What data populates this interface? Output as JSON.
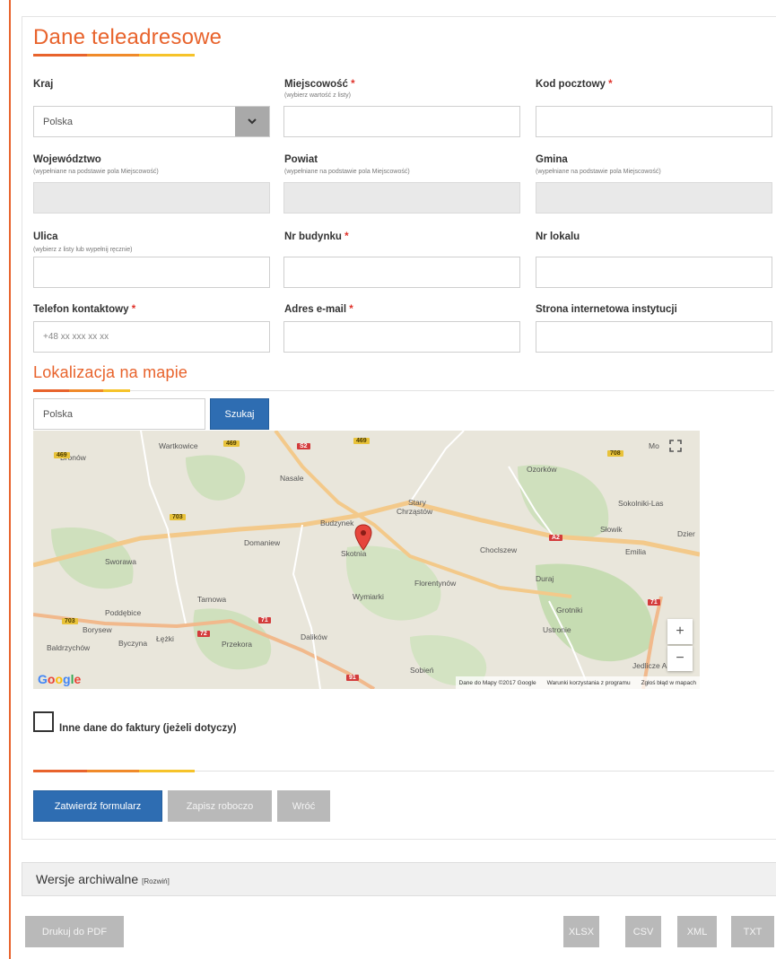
{
  "section_title": "Dane teleadresowe",
  "fields": {
    "kraj": {
      "label": "Kraj",
      "value": "Polska"
    },
    "miejscowosc": {
      "label": "Miejscowość",
      "required": "*",
      "hint": "(wybierz wartość z listy)",
      "value": ""
    },
    "kod": {
      "label": "Kod pocztowy",
      "required": "*",
      "value": ""
    },
    "wojewodztwo": {
      "label": "Województwo",
      "hint": "(wypełniane na podstawie pola Miejscowość)",
      "value": ""
    },
    "powiat": {
      "label": "Powiat",
      "hint": "(wypełniane na podstawie pola Miejscowość)",
      "value": ""
    },
    "gmina": {
      "label": "Gmina",
      "hint": "(wypełniane na podstawie pola Miejscowość)",
      "value": ""
    },
    "ulica": {
      "label": "Ulica",
      "hint": "(wybierz z listy lub wypełnij ręcznie)",
      "value": ""
    },
    "nr_budynku": {
      "label": "Nr budynku",
      "required": "*",
      "value": ""
    },
    "nr_lokalu": {
      "label": "Nr lokalu",
      "value": ""
    },
    "telefon": {
      "label": "Telefon kontaktowy",
      "required": "*",
      "placeholder": "+48 xx xxx xx xx"
    },
    "email": {
      "label": "Adres e-mail",
      "required": "*",
      "value": ""
    },
    "www": {
      "label": "Strona internetowa instytucji",
      "value": ""
    }
  },
  "map_section": {
    "title": "Lokalizacja na mapie",
    "search_value": "Polska",
    "search_button": "Szukaj",
    "places": {
      "wartkowice": "Wartkowice",
      "bronow": "Bronów",
      "nasale": "Nasale",
      "stary": "Stary",
      "chrzastow": "Chrząstów",
      "ozorkow": "Ozorków",
      "sokolniki": "Sokolniki-Las",
      "budzynek": "Budzynek",
      "domaniew": "Domaniew",
      "skotnia": "Skotnia",
      "sworawa": "Sworawa",
      "choclszew": "Choclszew",
      "slowik": "Słowik",
      "emilia": "Emilia",
      "dzier": "Dzier",
      "duraj": "Duraj",
      "florentynow": "Florentynów",
      "tarnowa": "Tarnowa",
      "wymiarki": "Wymiarki",
      "grotniki": "Grotniki",
      "poddebice": "Poddębice",
      "ustronie": "Ustronie",
      "borysew": "Borysew",
      "lezki": "Łężki",
      "byczyna": "Byczyna",
      "baldrzychow": "Baldrzychów",
      "przekora": "Przekora",
      "dalikow": "Dalików",
      "sobien": "Sobień",
      "jedlicze": "Jedlicze A",
      "mo": "Mo"
    },
    "roads": {
      "r469a": "469",
      "r469b": "469",
      "r469c": "469",
      "rs1": "S2",
      "r708": "708",
      "r703a": "703",
      "r703b": "703",
      "ra2": "A2",
      "r71": "71",
      "r72": "72",
      "r91": "91",
      "r714": "71"
    },
    "google": "Google",
    "footer": {
      "data": "Dane do Mapy ©2017 Google",
      "terms": "Warunki korzystania z programu",
      "report": "Zgłoś błąd w mapach"
    },
    "zoom_in": "+",
    "zoom_out": "−"
  },
  "invoice_checkbox_label": "Inne dane do faktury (jeżeli dotyczy)",
  "buttons": {
    "submit": "Zatwierdź formularz",
    "draft": "Zapisz roboczo",
    "back": "Wróć"
  },
  "archive": {
    "title": "Wersje archiwalne",
    "toggle": "[Rozwiń]"
  },
  "export": {
    "pdf": "Drukuj do PDF",
    "xlsx": "XLSX",
    "csv": "CSV",
    "xml": "XML",
    "txt": "TXT"
  },
  "colors": {
    "accent": "#e8632c",
    "primary": "#2e6db2",
    "required": "#e0332b",
    "disabled": "#e9e9e9"
  }
}
